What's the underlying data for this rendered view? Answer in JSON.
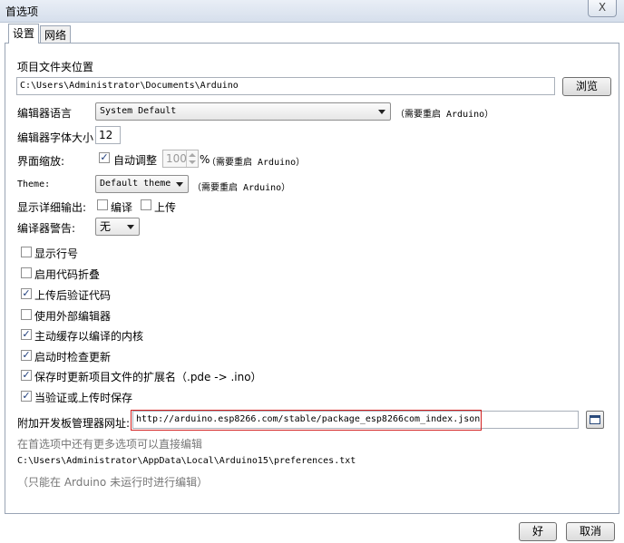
{
  "window": {
    "title": "首选项",
    "close_label": "X"
  },
  "tabs": [
    {
      "label": "设置"
    },
    {
      "label": "网络"
    }
  ],
  "sketchbook": {
    "label": "项目文件夹位置",
    "value": "C:\\Users\\Administrator\\Documents\\Arduino",
    "browse_label": "浏览"
  },
  "editor_language": {
    "label": "编辑器语言",
    "value": "System Default",
    "note": "（需要重启 Arduino）"
  },
  "editor_font_size": {
    "label": "编辑器字体大小",
    "value": "12"
  },
  "interface_scale": {
    "label": "界面缩放:",
    "auto_label": "自动调整",
    "auto_checked": true,
    "value": "100",
    "percent": "%",
    "note": "（需要重启 Arduino）"
  },
  "theme": {
    "label": "Theme:",
    "value": "Default theme",
    "note": "（需要重启 Arduino）"
  },
  "verbose": {
    "label": "显示详细输出:",
    "compile_label": "编译",
    "compile_checked": false,
    "upload_label": "上传",
    "upload_checked": false
  },
  "compiler_warnings": {
    "label": "编译器警告:",
    "value": "无"
  },
  "options": [
    {
      "label": "显示行号",
      "checked": false
    },
    {
      "label": "启用代码折叠",
      "checked": false
    },
    {
      "label": "上传后验证代码",
      "checked": true
    },
    {
      "label": "使用外部编辑器",
      "checked": false
    },
    {
      "label": "主动缓存以编译的内核",
      "checked": true
    },
    {
      "label": "启动时检查更新",
      "checked": true
    },
    {
      "label": "保存时更新项目文件的扩展名（.pde -> .ino）",
      "checked": true
    },
    {
      "label": "当验证或上传时保存",
      "checked": true
    }
  ],
  "boards_manager": {
    "label": "附加开发板管理器网址:",
    "value": "http://arduino.esp8266.com/stable/package_esp8266com_index.json"
  },
  "more_prefs": {
    "text": "在首选项中还有更多选项可以直接编辑"
  },
  "prefs_path": {
    "text": "C:\\Users\\Administrator\\AppData\\Local\\Arduino15\\preferences.txt"
  },
  "edit_note": {
    "text": "（只能在 Arduino 未运行时进行编辑）"
  },
  "footer": {
    "ok_label": "好",
    "cancel_label": "取消"
  }
}
